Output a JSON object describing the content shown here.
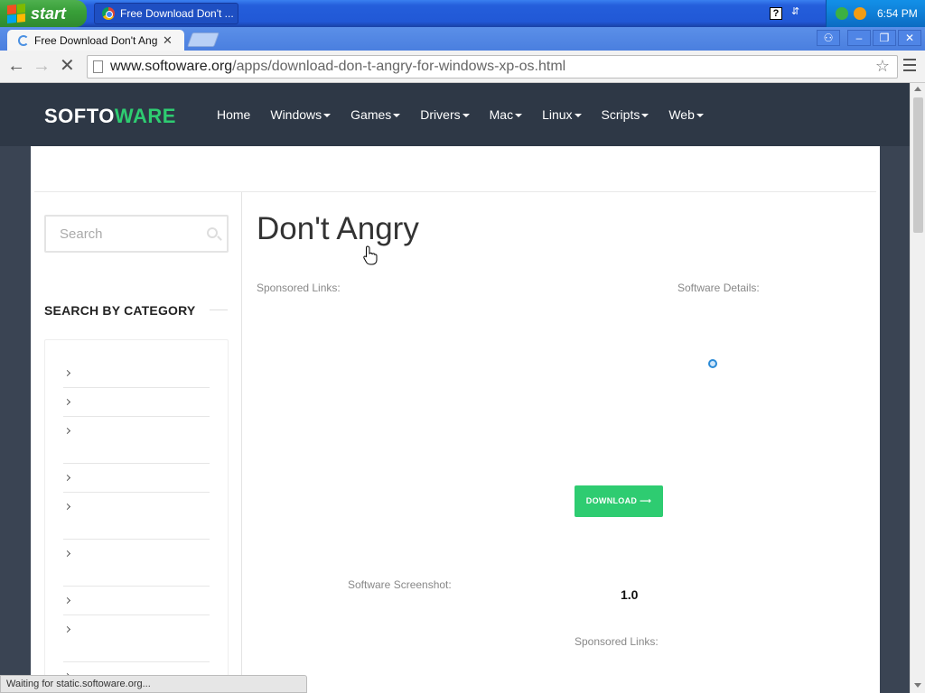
{
  "taskbar": {
    "start_label": "start",
    "task_title": "Free Download Don't ...",
    "clock": "6:54 PM"
  },
  "browser": {
    "tab_title": "Free Download Don't Angry",
    "url_host": "www.softoware.org",
    "url_path": "/apps/download-don-t-angry-for-windows-xp-os.html",
    "status_text": "Waiting for static.softoware.org..."
  },
  "site": {
    "logo_part1": "SOFTO",
    "logo_part2": "WARE",
    "nav": [
      {
        "label": "Home"
      },
      {
        "label": "Windows"
      },
      {
        "label": "Games"
      },
      {
        "label": "Drivers"
      },
      {
        "label": "Mac"
      },
      {
        "label": "Linux"
      },
      {
        "label": "Scripts"
      },
      {
        "label": "Web"
      }
    ]
  },
  "sidebar": {
    "search_placeholder": "Search",
    "category_title": "SEARCH BY CATEGORY"
  },
  "main": {
    "title": "Don't Angry",
    "sponsored_label": "Sponsored Links:",
    "details_label": "Software Details:",
    "download_label": "DOWNLOAD ⟶",
    "screenshot_label": "Software Screenshot:",
    "version": "1.0",
    "sponsored_label_2": "Sponsored Links:"
  },
  "colors": {
    "accent": "#2ecc71",
    "header_bg": "#2e3846"
  }
}
